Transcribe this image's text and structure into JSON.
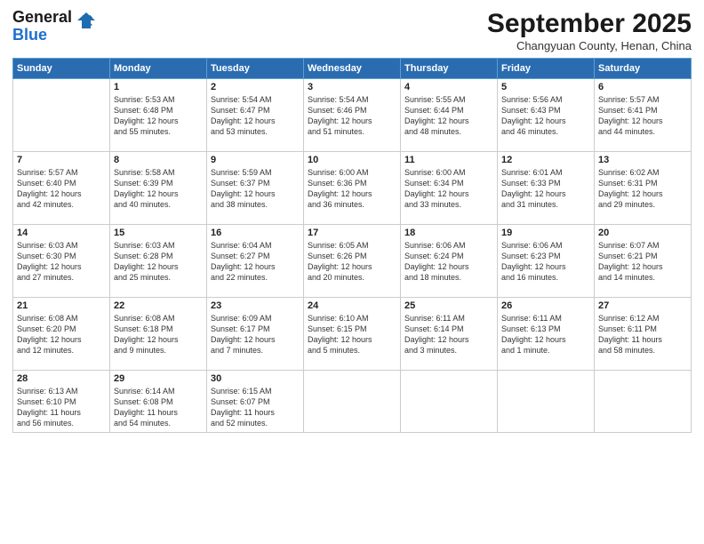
{
  "header": {
    "logo_line1": "General",
    "logo_line2": "Blue",
    "month": "September 2025",
    "location": "Changyuan County, Henan, China"
  },
  "weekdays": [
    "Sunday",
    "Monday",
    "Tuesday",
    "Wednesday",
    "Thursday",
    "Friday",
    "Saturday"
  ],
  "weeks": [
    [
      {
        "day": "",
        "info": ""
      },
      {
        "day": "1",
        "info": "Sunrise: 5:53 AM\nSunset: 6:48 PM\nDaylight: 12 hours\nand 55 minutes."
      },
      {
        "day": "2",
        "info": "Sunrise: 5:54 AM\nSunset: 6:47 PM\nDaylight: 12 hours\nand 53 minutes."
      },
      {
        "day": "3",
        "info": "Sunrise: 5:54 AM\nSunset: 6:46 PM\nDaylight: 12 hours\nand 51 minutes."
      },
      {
        "day": "4",
        "info": "Sunrise: 5:55 AM\nSunset: 6:44 PM\nDaylight: 12 hours\nand 48 minutes."
      },
      {
        "day": "5",
        "info": "Sunrise: 5:56 AM\nSunset: 6:43 PM\nDaylight: 12 hours\nand 46 minutes."
      },
      {
        "day": "6",
        "info": "Sunrise: 5:57 AM\nSunset: 6:41 PM\nDaylight: 12 hours\nand 44 minutes."
      }
    ],
    [
      {
        "day": "7",
        "info": "Sunrise: 5:57 AM\nSunset: 6:40 PM\nDaylight: 12 hours\nand 42 minutes."
      },
      {
        "day": "8",
        "info": "Sunrise: 5:58 AM\nSunset: 6:39 PM\nDaylight: 12 hours\nand 40 minutes."
      },
      {
        "day": "9",
        "info": "Sunrise: 5:59 AM\nSunset: 6:37 PM\nDaylight: 12 hours\nand 38 minutes."
      },
      {
        "day": "10",
        "info": "Sunrise: 6:00 AM\nSunset: 6:36 PM\nDaylight: 12 hours\nand 36 minutes."
      },
      {
        "day": "11",
        "info": "Sunrise: 6:00 AM\nSunset: 6:34 PM\nDaylight: 12 hours\nand 33 minutes."
      },
      {
        "day": "12",
        "info": "Sunrise: 6:01 AM\nSunset: 6:33 PM\nDaylight: 12 hours\nand 31 minutes."
      },
      {
        "day": "13",
        "info": "Sunrise: 6:02 AM\nSunset: 6:31 PM\nDaylight: 12 hours\nand 29 minutes."
      }
    ],
    [
      {
        "day": "14",
        "info": "Sunrise: 6:03 AM\nSunset: 6:30 PM\nDaylight: 12 hours\nand 27 minutes."
      },
      {
        "day": "15",
        "info": "Sunrise: 6:03 AM\nSunset: 6:28 PM\nDaylight: 12 hours\nand 25 minutes."
      },
      {
        "day": "16",
        "info": "Sunrise: 6:04 AM\nSunset: 6:27 PM\nDaylight: 12 hours\nand 22 minutes."
      },
      {
        "day": "17",
        "info": "Sunrise: 6:05 AM\nSunset: 6:26 PM\nDaylight: 12 hours\nand 20 minutes."
      },
      {
        "day": "18",
        "info": "Sunrise: 6:06 AM\nSunset: 6:24 PM\nDaylight: 12 hours\nand 18 minutes."
      },
      {
        "day": "19",
        "info": "Sunrise: 6:06 AM\nSunset: 6:23 PM\nDaylight: 12 hours\nand 16 minutes."
      },
      {
        "day": "20",
        "info": "Sunrise: 6:07 AM\nSunset: 6:21 PM\nDaylight: 12 hours\nand 14 minutes."
      }
    ],
    [
      {
        "day": "21",
        "info": "Sunrise: 6:08 AM\nSunset: 6:20 PM\nDaylight: 12 hours\nand 12 minutes."
      },
      {
        "day": "22",
        "info": "Sunrise: 6:08 AM\nSunset: 6:18 PM\nDaylight: 12 hours\nand 9 minutes."
      },
      {
        "day": "23",
        "info": "Sunrise: 6:09 AM\nSunset: 6:17 PM\nDaylight: 12 hours\nand 7 minutes."
      },
      {
        "day": "24",
        "info": "Sunrise: 6:10 AM\nSunset: 6:15 PM\nDaylight: 12 hours\nand 5 minutes."
      },
      {
        "day": "25",
        "info": "Sunrise: 6:11 AM\nSunset: 6:14 PM\nDaylight: 12 hours\nand 3 minutes."
      },
      {
        "day": "26",
        "info": "Sunrise: 6:11 AM\nSunset: 6:13 PM\nDaylight: 12 hours\nand 1 minute."
      },
      {
        "day": "27",
        "info": "Sunrise: 6:12 AM\nSunset: 6:11 PM\nDaylight: 11 hours\nand 58 minutes."
      }
    ],
    [
      {
        "day": "28",
        "info": "Sunrise: 6:13 AM\nSunset: 6:10 PM\nDaylight: 11 hours\nand 56 minutes."
      },
      {
        "day": "29",
        "info": "Sunrise: 6:14 AM\nSunset: 6:08 PM\nDaylight: 11 hours\nand 54 minutes."
      },
      {
        "day": "30",
        "info": "Sunrise: 6:15 AM\nSunset: 6:07 PM\nDaylight: 11 hours\nand 52 minutes."
      },
      {
        "day": "",
        "info": ""
      },
      {
        "day": "",
        "info": ""
      },
      {
        "day": "",
        "info": ""
      },
      {
        "day": "",
        "info": ""
      }
    ]
  ]
}
